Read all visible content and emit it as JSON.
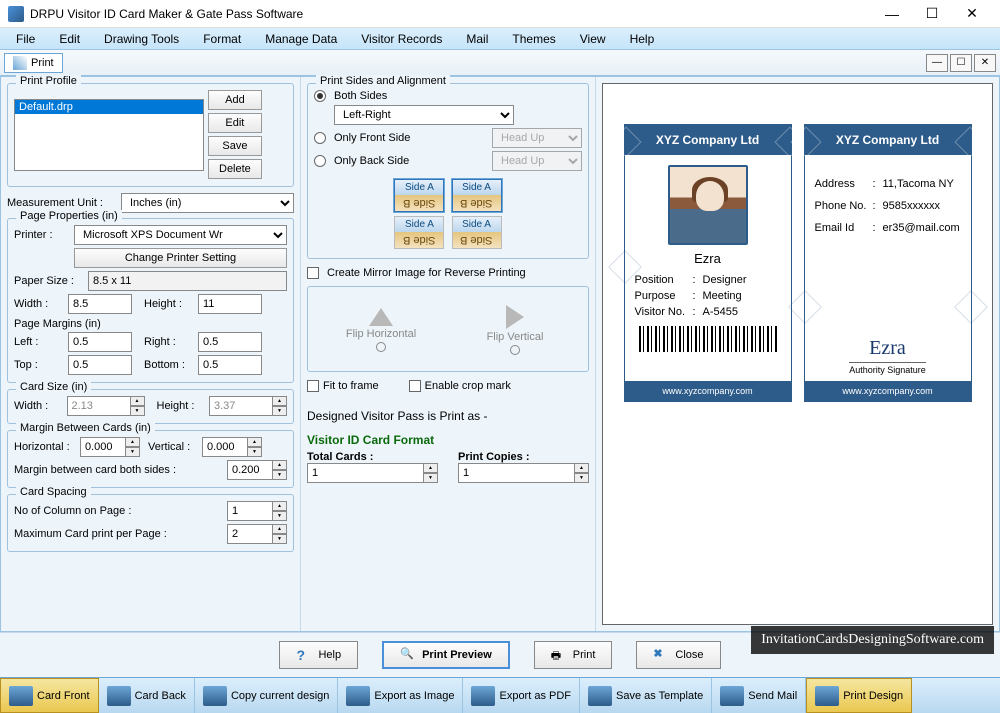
{
  "app": {
    "title": "DRPU Visitor ID Card Maker & Gate Pass Software"
  },
  "menu": [
    "File",
    "Edit",
    "Drawing Tools",
    "Format",
    "Manage Data",
    "Visitor Records",
    "Mail",
    "Themes",
    "View",
    "Help"
  ],
  "printTab": "Print",
  "profile": {
    "legend": "Print Profile",
    "items": [
      "Default.drp"
    ],
    "buttons": [
      "Add",
      "Edit",
      "Save",
      "Delete"
    ]
  },
  "measurement": {
    "label": "Measurement Unit :",
    "value": "Inches (in)"
  },
  "pageProps": {
    "legend": "Page Properties (in)",
    "printerLabel": "Printer :",
    "printer": "Microsoft XPS Document Wr",
    "changePrinter": "Change Printer Setting",
    "paperSizeLbl": "Paper Size :",
    "paperSize": "8.5 x 11",
    "widthLbl": "Width :",
    "width": "8.5",
    "heightLbl": "Height :",
    "height": "11",
    "marginsLegend": "Page Margins (in)",
    "leftLbl": "Left :",
    "left": "0.5",
    "rightLbl": "Right :",
    "right": "0.5",
    "topLbl": "Top :",
    "top": "0.5",
    "bottomLbl": "Bottom :",
    "bottom": "0.5"
  },
  "cardSize": {
    "legend": "Card Size (in)",
    "widthLbl": "Width :",
    "width": "2.13",
    "heightLbl": "Height :",
    "height": "3.37"
  },
  "marginBetween": {
    "legend": "Margin Between Cards (in)",
    "hLbl": "Horizontal :",
    "h": "0.000",
    "vLbl": "Vertical :",
    "v": "0.000",
    "bothLbl": "Margin between card both sides :",
    "both": "0.200"
  },
  "spacing": {
    "legend": "Card Spacing",
    "colsLbl": "No of Column on Page :",
    "cols": "1",
    "maxLbl": "Maximum Card print per Page :",
    "max": "2"
  },
  "sides": {
    "legend": "Print Sides and Alignment",
    "both": "Both Sides",
    "bothCombo": "Left-Right",
    "front": "Only Front Side",
    "frontCombo": "Head Up",
    "back": "Only Back Side",
    "backCombo": "Head Up",
    "sideA": "Side A",
    "sideB": "Side B",
    "mirror": "Create Mirror Image for Reverse Printing",
    "flipH": "Flip Horizontal",
    "flipV": "Flip Vertical",
    "fit": "Fit to frame",
    "crop": "Enable crop mark",
    "designedAs": "Designed Visitor Pass is Print as -",
    "formatHdr": "Visitor ID Card Format",
    "totalLbl": "Total Cards :",
    "total": "1",
    "copiesLbl": "Print Copies :",
    "copies": "1"
  },
  "bottom": {
    "help": "Help",
    "preview": "Print Preview",
    "print": "Print",
    "close": "Close"
  },
  "statusbar": [
    "Card Front",
    "Card Back",
    "Copy current design",
    "Export as Image",
    "Export as PDF",
    "Save as Template",
    "Send Mail",
    "Print Design"
  ],
  "watermark": "InvitationCardsDesigningSoftware.com",
  "card": {
    "company": "XYZ Company Ltd",
    "name": "Ezra",
    "position": {
      "k": "Position",
      "v": "Designer"
    },
    "purpose": {
      "k": "Purpose",
      "v": "Meeting"
    },
    "visitor": {
      "k": "Visitor No.",
      "v": "A-5455"
    },
    "addressK": "Address",
    "address": "11,Tacoma NY",
    "phoneK": "Phone No.",
    "phone": "9585xxxxxx",
    "emailK": "Email Id",
    "email": "er35@mail.com",
    "sigLabel": "Authority Signature",
    "url": "www.xyzcompany.com"
  }
}
